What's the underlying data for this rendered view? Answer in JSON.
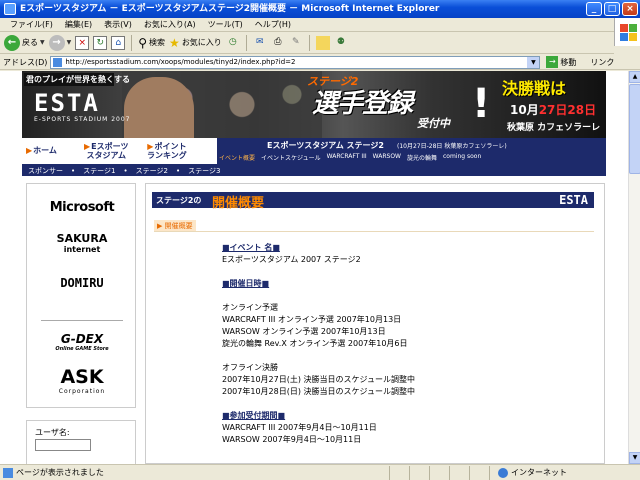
{
  "window": {
    "title": "Eスポーツスタジアム － Eスポーツスタジアムステージ2開催概要 － Microsoft Internet Explorer",
    "controls": [
      "_",
      "□",
      "×"
    ]
  },
  "menu": [
    "ファイル(F)",
    "編集(E)",
    "表示(V)",
    "お気に入り(A)",
    "ツール(T)",
    "ヘルプ(H)"
  ],
  "toolbar": {
    "back": "戻る",
    "search": "検索",
    "favorites": "お気に入り"
  },
  "address": {
    "label": "アドレス(D)",
    "url": "http://esportsstadium.com/xoops/modules/tinyd2/index.php?id=2",
    "go": "移動",
    "links": "リンク"
  },
  "banner": {
    "tagline": "君のプレイが世界を熱くする",
    "logo": "ESTA",
    "logo_sub": "E-SPORTS STADIUM 2007",
    "stage": "ステージ2",
    "entry": "選手登録",
    "accepting": "受付中",
    "bang": "!",
    "final_title": "決勝戦は",
    "final_month": "10月",
    "final_day1": "27日",
    "final_day2": "28日",
    "final_venue": "秋葉原 カフェソラーレ"
  },
  "nav": {
    "items": [
      {
        "label": "ホーム"
      },
      {
        "label": "Eスポーツ\nスタジアム"
      },
      {
        "label": "ポイント\nランキング"
      }
    ],
    "stage_title": "Eスポーツスタジアム ステージ2",
    "stage_sub": "(10月27日-28日 秋葉原カフェソラーレ)",
    "stage_links": [
      "イベント概要",
      "イベントスケジュール",
      "WARCRAFT III",
      "WARSOW",
      "旋光の輪舞",
      "coming soon"
    ],
    "subnav": [
      "スポンサー",
      "ステージ1",
      "ステージ2",
      "ステージ3"
    ]
  },
  "sidebar": {
    "sponsors": {
      "ms": "Microsoft",
      "sakura_top": "SAKURA",
      "sakura_bottom": "internet",
      "domiru": "DOMIRU",
      "gdex": "G-DEX",
      "gdex_sub": "Online GAME Store",
      "ask": "ASK",
      "ask_sub": "Corporation"
    },
    "login_label": "ユーザ名:",
    "login_value": ""
  },
  "main": {
    "stage": "ステージ2の",
    "page_title": "開催概要",
    "logo": "ESTA",
    "section_tag": "開催概要",
    "h_event": "■イベント 名■",
    "event_name": "Eスポーツスタジアム 2007 ステージ2",
    "h_dates": "■開催日時■",
    "online_label": "オンライン予選",
    "online1": "WARCRAFT III オンライン予選 2007年10月13日",
    "online2": "WARSOW オンライン予選 2007年10月13日",
    "online3": "旋光の輪舞 Rev.X オンライン予選 2007年10月6日",
    "offline_label": "オフライン決勝",
    "offline1": "2007年10月27日(土) 決勝当日のスケジュール調整中",
    "offline2": "2007年10月28日(日) 決勝当日のスケジュール調整中",
    "h_entry": "■参加受付期間■",
    "entry1": "WARCRAFT III 2007年9月4日～10月11日",
    "entry2": "WARSOW 2007年9月4日～10月11日"
  },
  "status": {
    "text": "ページが表示されました",
    "zone": "インターネット"
  }
}
